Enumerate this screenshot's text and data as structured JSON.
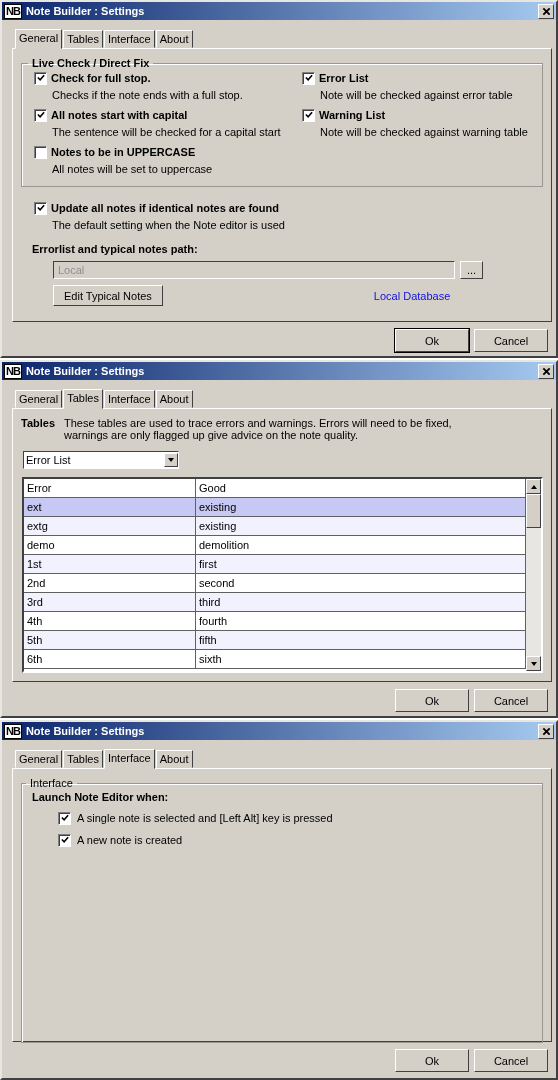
{
  "windows": [
    {
      "title": "Note Builder : Settings",
      "icon": "NB",
      "tabs": [
        {
          "label": "General",
          "selected": true
        },
        {
          "label": "Tables",
          "selected": false
        },
        {
          "label": "Interface",
          "selected": false
        },
        {
          "label": "About",
          "selected": false
        }
      ],
      "panel": {
        "kind": "general",
        "group": "Live Check / Direct Fix",
        "columns": [
          {
            "options": [
              {
                "label": "Check for full stop.",
                "description": "Checks if the note ends with a full stop.",
                "checked": true
              },
              {
                "label": "All notes start with capital",
                "description": "The sentence will be checked for a capital start",
                "checked": true
              },
              {
                "label": "Notes to be in UPPERCASE",
                "description": "All notes will be set to uppercase",
                "checked": false
              }
            ]
          },
          {
            "options": [
              {
                "label": "Error List",
                "description": "Note will be checked against error table",
                "checked": true
              },
              {
                "label": "Warning List",
                "description": "Note will be checked against warning table",
                "checked": true
              }
            ]
          }
        ],
        "update_option": {
          "label": "Update all notes if identical notes are found",
          "description": "The default setting when the Note editor is used",
          "checked": true
        },
        "path_label": "Errorlist and typical notes path:",
        "path_field": {
          "value": "Local",
          "disabled": true
        },
        "browse_button": "...",
        "edit_button": "Edit Typical Notes",
        "link": "Local Database"
      },
      "buttons": [
        {
          "label": "Ok",
          "default": true
        },
        {
          "label": "Cancel",
          "default": false
        }
      ]
    },
    {
      "title": "Note Builder : Settings",
      "icon": "NB",
      "tabs": [
        {
          "label": "General",
          "selected": false
        },
        {
          "label": "Tables",
          "selected": true
        },
        {
          "label": "Interface",
          "selected": false
        },
        {
          "label": "About",
          "selected": false
        }
      ],
      "panel": {
        "kind": "tables",
        "heading": "Tables",
        "description": "These tables are used to trace errors and warnings. Errors will need to be fixed, warnings are only flagged up give advice on the note quality.",
        "dropdown": "Error List",
        "table": {
          "columns": [
            "Error",
            "Good"
          ],
          "rows": [
            {
              "cells": [
                "ext",
                "existing"
              ],
              "selected": true
            },
            {
              "cells": [
                "extg",
                "existing"
              ],
              "selected": false
            },
            {
              "cells": [
                "demo",
                "demolition"
              ],
              "selected": false
            },
            {
              "cells": [
                "1st",
                "first"
              ],
              "selected": false
            },
            {
              "cells": [
                "2nd",
                "second"
              ],
              "selected": false
            },
            {
              "cells": [
                "3rd",
                "third"
              ],
              "selected": false
            },
            {
              "cells": [
                "4th",
                "fourth"
              ],
              "selected": false
            },
            {
              "cells": [
                "5th",
                "fifth"
              ],
              "selected": false
            },
            {
              "cells": [
                "6th",
                "sixth"
              ],
              "selected": false
            }
          ]
        }
      },
      "buttons": [
        {
          "label": "Ok",
          "default": false
        },
        {
          "label": "Cancel",
          "default": false
        }
      ]
    },
    {
      "title": "Note Builder : Settings",
      "icon": "NB",
      "tabs": [
        {
          "label": "General",
          "selected": false
        },
        {
          "label": "Tables",
          "selected": false
        },
        {
          "label": "Interface",
          "selected": true
        },
        {
          "label": "About",
          "selected": false
        }
      ],
      "panel": {
        "kind": "interface",
        "group": "Interface",
        "heading": "Launch Note Editor when:",
        "options": [
          {
            "label": "A single note is selected and [Left Alt] key is pressed",
            "checked": true
          },
          {
            "label": "A new note is created",
            "checked": true
          }
        ]
      },
      "buttons": [
        {
          "label": "Ok",
          "default": false
        },
        {
          "label": "Cancel",
          "default": false
        }
      ]
    }
  ]
}
